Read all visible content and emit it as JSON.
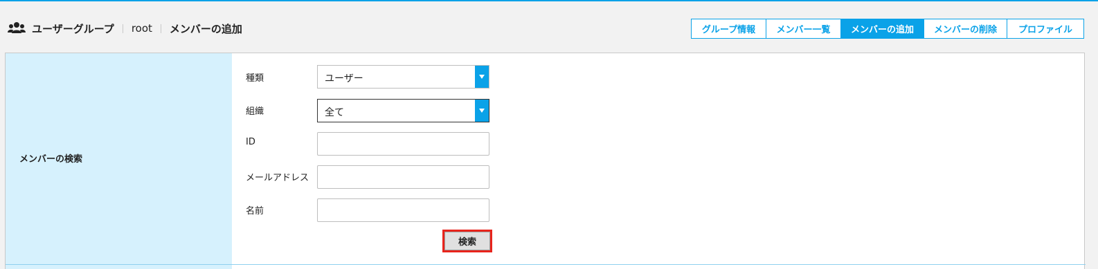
{
  "breadcrumb": {
    "icon": "users-icon",
    "group_label": "ユーザーグループ",
    "group_name": "root",
    "current_page": "メンバーの追加"
  },
  "tabs": [
    {
      "label": "グループ情報",
      "active": false
    },
    {
      "label": "メンバー一覧",
      "active": false
    },
    {
      "label": "メンバーの追加",
      "active": true
    },
    {
      "label": "メンバーの削除",
      "active": false
    },
    {
      "label": "プロファイル",
      "active": false
    }
  ],
  "search_section": {
    "title": "メンバーの検索",
    "fields": {
      "type": {
        "label": "種類",
        "value": "ユーザー"
      },
      "org": {
        "label": "組織",
        "value": "全て"
      },
      "id": {
        "label": "ID",
        "value": ""
      },
      "email": {
        "label": "メールアドレス",
        "value": ""
      },
      "name": {
        "label": "名前",
        "value": ""
      }
    },
    "search_button": "検索"
  },
  "colors": {
    "accent": "#0aa2e8",
    "left_panel_bg": "#d6f1fd",
    "highlight": "#e8241c"
  }
}
